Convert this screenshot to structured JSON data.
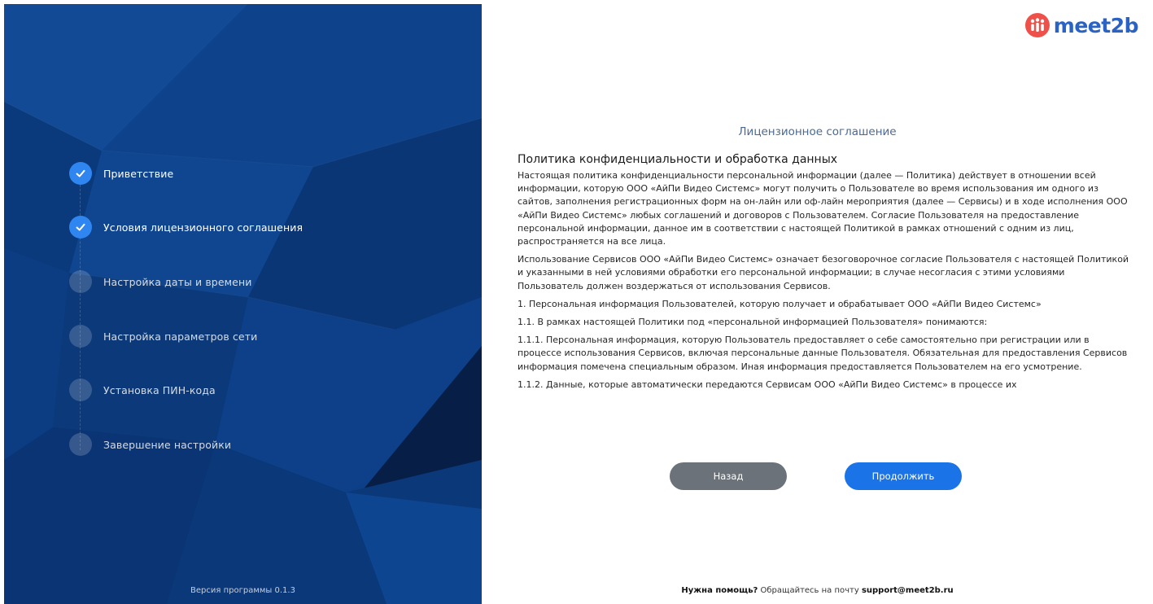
{
  "sidebar": {
    "steps": [
      {
        "label": "Приветствие",
        "state": "done"
      },
      {
        "label": "Условия лицензионного соглашения",
        "state": "done"
      },
      {
        "label": "Настройка даты и времени",
        "state": "pending"
      },
      {
        "label": "Настройка параметров сети",
        "state": "pending"
      },
      {
        "label": "Установка ПИН-кода",
        "state": "pending"
      },
      {
        "label": "Завершение настройки",
        "state": "pending"
      }
    ],
    "version": "Версия программы 0.1.3"
  },
  "brand": {
    "name": "meet2b",
    "logo_icon": "meet2b-logo-icon",
    "color": "#2a63c4",
    "accent": "#f0504a"
  },
  "main": {
    "heading": "Лицензионное соглашение",
    "doc_title": "Политика конфиденциальности и обработка данных",
    "paragraphs": [
      "Настоящая политика конфиденциальности персональной информации (далее — Политика) действует в отношении всей информации, которую ООО «АйПи Видео Системс» могут получить о Пользователе во время использования им одного из сайтов, заполнения регистрационных форм на он-лайн или оф-лайн мероприятия (далее — Сервисы) и в ходе исполнения ООО «АйПи Видео Системс» любых соглашений и договоров с Пользователем. Согласие Пользователя на предоставление персональной информации, данное им в соответствии с настоящей Политикой в рамках отношений с одним из лиц, распространяется на все лица.",
      "Использование Сервисов ООО «АйПи Видео Системс» означает безоговорочное согласие Пользователя с настоящей Политикой и указанными в ней условиями обработки его персональной информации; в случае несогласия с этими условиями Пользователь должен воздержаться от использования Сервисов.",
      "1. Персональная информация Пользователей, которую получает и обрабатывает ООО «АйПи Видео Системс»",
      "1.1. В рамках настоящей Политики под «персональной информацией Пользователя» понимаются:",
      "1.1.1. Персональная информация, которую Пользователь предоставляет о себе самостоятельно при регистрации или в процессе использования Сервисов, включая персональные данные Пользователя. Обязательная для предоставления Сервисов информация помечена специальным образом. Иная информация предоставляется Пользователем на его усмотрение.",
      "1.1.2. Данные, которые автоматически передаются Сервисам ООО «АйПи Видео Системс» в процессе их"
    ],
    "back_label": "Назад",
    "next_label": "Продолжить"
  },
  "footer": {
    "help_bold": "Нужна помощь?",
    "help_text": " Обращайтесь на почту ",
    "help_email": "support@meet2b.ru"
  },
  "colors": {
    "sidebar_bg": "#0c3d82",
    "step_done": "#2f86f0",
    "back_button": "#6b7279",
    "next_button": "#1b73e8"
  }
}
